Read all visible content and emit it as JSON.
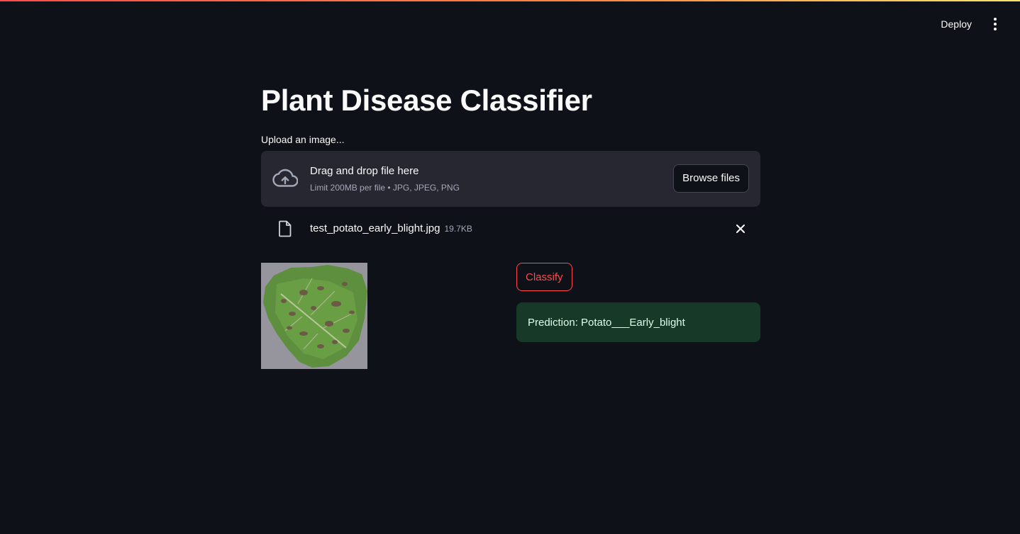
{
  "header": {
    "deploy_label": "Deploy",
    "menu_icon": "kebab-menu-icon"
  },
  "main": {
    "title": "Plant Disease Classifier",
    "uploader": {
      "label": "Upload an image...",
      "drop_title": "Drag and drop file here",
      "drop_subtitle": "Limit 200MB per file • JPG, JPEG, PNG",
      "browse_label": "Browse files",
      "icon": "cloud-upload-icon"
    },
    "uploaded_file": {
      "name": "test_potato_early_blight.jpg",
      "size": "19.7KB",
      "icon": "file-icon",
      "remove_icon": "close-icon"
    },
    "classify_label": "Classify",
    "prediction": "Prediction: Potato___Early_blight"
  },
  "colors": {
    "background": "#0e1117",
    "dropzone": "#262730",
    "accent": "#ff4b4b",
    "success_bg": "#173928",
    "success_text": "#dffde9"
  }
}
